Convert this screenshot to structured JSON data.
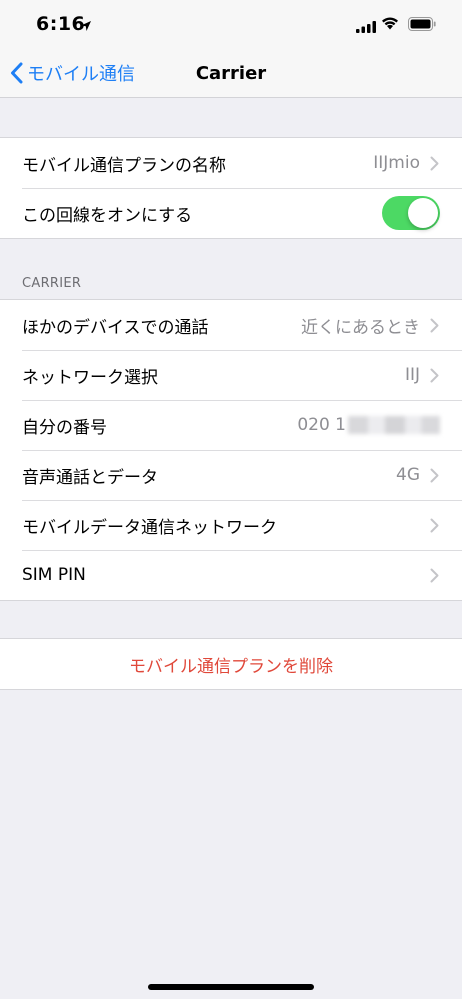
{
  "status_bar": {
    "time": "6:16",
    "icons": [
      "location-arrow-icon",
      "cellular-signal-icon",
      "wifi-icon",
      "battery-icon"
    ]
  },
  "nav": {
    "back_label": "モバイル通信",
    "title": "Carrier"
  },
  "plan_group": {
    "plan_name_label": "モバイル通信プランの名称",
    "plan_name_value": "IIJmio",
    "line_on_label": "この回線をオンにする",
    "line_on_state": true
  },
  "carrier_section": {
    "header": "CARRIER",
    "rows": [
      {
        "label": "ほかのデバイスでの通話",
        "value": "近くにあるとき"
      },
      {
        "label": "ネットワーク選択",
        "value": "IIJ"
      },
      {
        "label": "自分の番号",
        "value": "020 1"
      },
      {
        "label": "音声通話とデータ",
        "value": "4G"
      },
      {
        "label": "モバイルデータ通信ネットワーク",
        "value": ""
      },
      {
        "label": "SIM PIN",
        "value": ""
      }
    ]
  },
  "delete": {
    "label": "モバイル通信プランを削除"
  },
  "colors": {
    "accent_blue": "#1e7ff5",
    "toggle_green": "#4cd964",
    "destructive_red": "#e0483a",
    "secondary_text": "#8e8e93",
    "background": "#efeff4"
  }
}
